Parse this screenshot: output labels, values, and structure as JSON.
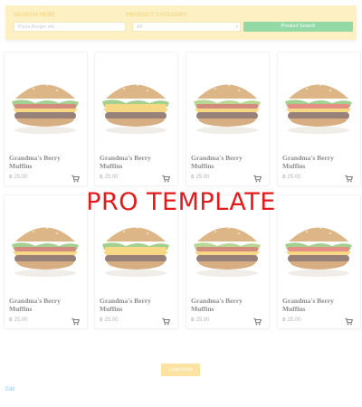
{
  "search": {
    "search_label": "SEARCH HERE",
    "search_placeholder": "Pizza,Burger etc",
    "category_label": "PRODUCT CATEGORY",
    "category_selected": "All",
    "button_label": "Product Search"
  },
  "products": [
    {
      "name": "Grandma's Berry Muffins",
      "price": "฿ 25.00",
      "image": "burger-with-bacon"
    },
    {
      "name": "Grandma's Berry Muffins",
      "price": "฿ 25.00",
      "image": "burger-with-cheese"
    },
    {
      "name": "Grandma's Berry Muffins",
      "price": "฿ 25.00",
      "image": "burger-with-onion"
    },
    {
      "name": "Grandma's Berry Muffins",
      "price": "฿ 25.00",
      "image": "burger-with-tomato"
    },
    {
      "name": "Grandma's Berry Muffins",
      "price": "฿ 25.00",
      "image": "burger-with-bacon"
    },
    {
      "name": "Grandma's Berry Muffins",
      "price": "฿ 25.00",
      "image": "burger-with-cheese"
    },
    {
      "name": "Grandma's Berry Muffins",
      "price": "฿ 25.00",
      "image": "burger-with-onion"
    },
    {
      "name": "Grandma's Berry Muffins",
      "price": "฿ 25.00",
      "image": "burger-with-tomato"
    }
  ],
  "watermark": "PRO TEMPLATE",
  "load_more_label": "Load More",
  "edit_link": "Edit",
  "colors": {
    "search_panel_bg": "#fdf0c2",
    "search_button_bg": "#93d9a5",
    "load_more_bg": "#fde3a1",
    "watermark": "#e41b1b",
    "edit_link": "#8ec7f2"
  }
}
